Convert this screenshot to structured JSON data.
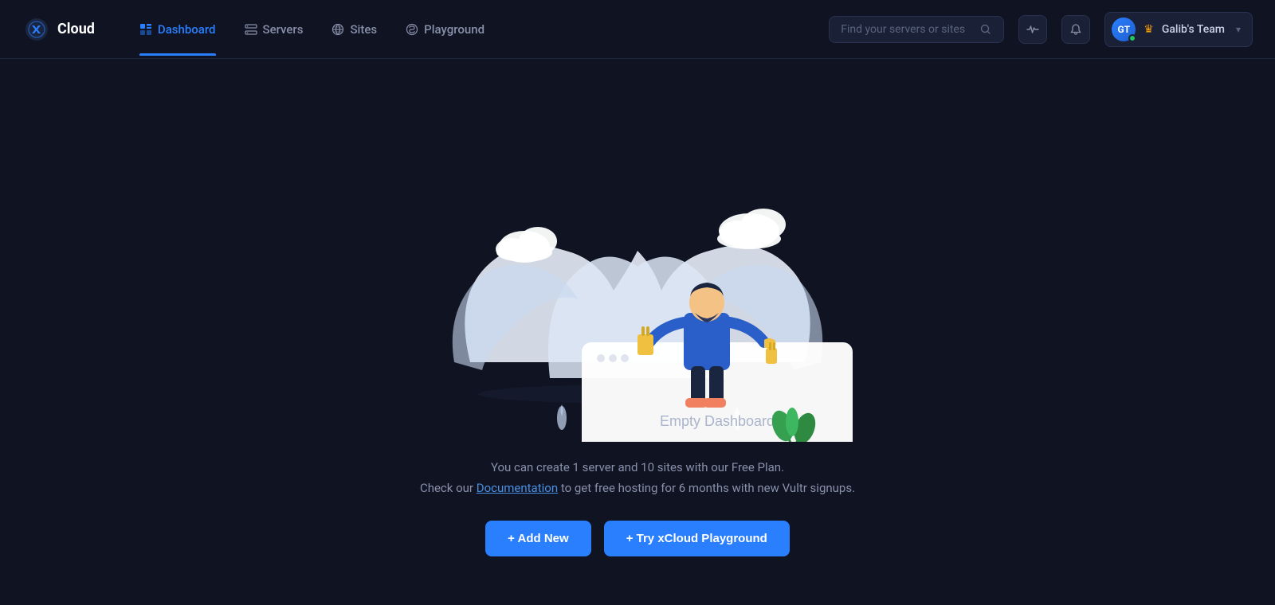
{
  "logo": {
    "text": "Cloud"
  },
  "nav": {
    "items": [
      {
        "id": "dashboard",
        "label": "Dashboard",
        "active": true
      },
      {
        "id": "servers",
        "label": "Servers",
        "active": false
      },
      {
        "id": "sites",
        "label": "Sites",
        "active": false
      },
      {
        "id": "playground",
        "label": "Playground",
        "active": false
      }
    ]
  },
  "search": {
    "placeholder": "Find your servers or sites"
  },
  "user": {
    "initials": "GT",
    "name": "Galib's Team"
  },
  "main": {
    "illustration_title": "Empty Dashboard",
    "description_line1": "You can create 1 server and 10 sites with our Free Plan.",
    "description_line2_pre": "Check our ",
    "description_link": "Documentation",
    "description_line2_post": " to get free hosting for 6 months with new Vultr signups.",
    "btn_add_new": "+ Add New",
    "btn_playground": "+ Try xCloud Playground"
  }
}
